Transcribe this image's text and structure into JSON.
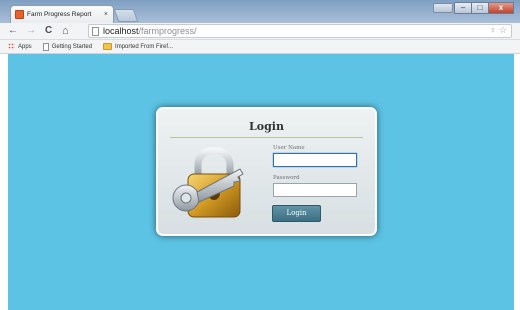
{
  "browser": {
    "tab": {
      "title": "Farm Progress Report",
      "close_glyph": "×"
    },
    "url": {
      "host": "localhost",
      "path": "/farmprogress/"
    },
    "nav": {
      "back": "←",
      "forward": "→",
      "reload": "C",
      "home": "⌂"
    },
    "omnibox_right": "♀ ☆",
    "bookmarks": [
      {
        "label": "Apps",
        "icon": "apps-grid-icon"
      },
      {
        "label": "Getting Started",
        "icon": "page-icon"
      },
      {
        "label": "Imported From Firef...",
        "icon": "folder-icon"
      }
    ],
    "window_controls": {
      "minimize": "–",
      "maximize": "□",
      "close": "x"
    }
  },
  "login": {
    "title": "Login",
    "username_label": "User Name",
    "username_value": "",
    "password_label": "Password",
    "password_value": "",
    "button_label": "Login"
  },
  "colors": {
    "page_background": "#5cc3e4",
    "button": "#4d8094",
    "card": "#dfe6e8"
  }
}
